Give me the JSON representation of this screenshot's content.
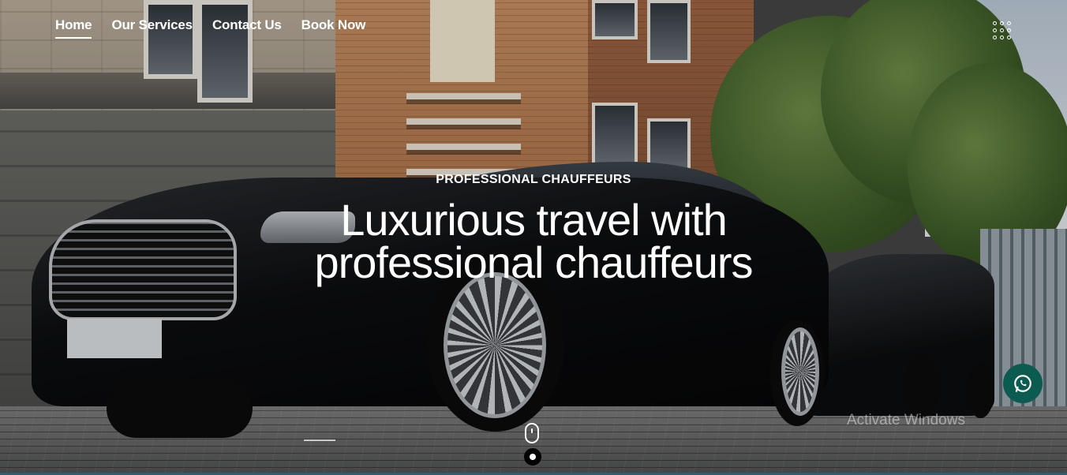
{
  "nav": {
    "items": [
      {
        "label": "Home",
        "active": true
      },
      {
        "label": "Our Services",
        "active": false
      },
      {
        "label": "Contact Us",
        "active": false
      },
      {
        "label": "Book Now",
        "active": false
      }
    ],
    "menu_icon": "grid-dots-icon"
  },
  "hero": {
    "eyebrow": "PROFESSIONAL CHAUFFEURS",
    "headline_line1": "Luxurious travel with",
    "headline_line2": "professional chauffeurs"
  },
  "scroll_indicator": {
    "icon": "mouse-scroll-icon"
  },
  "slider": {
    "active_dot_icon": "slide-dot-icon"
  },
  "whatsapp": {
    "icon": "whatsapp-icon",
    "color": "#0c5b50"
  },
  "watermark": {
    "text": "Activate Windows"
  }
}
